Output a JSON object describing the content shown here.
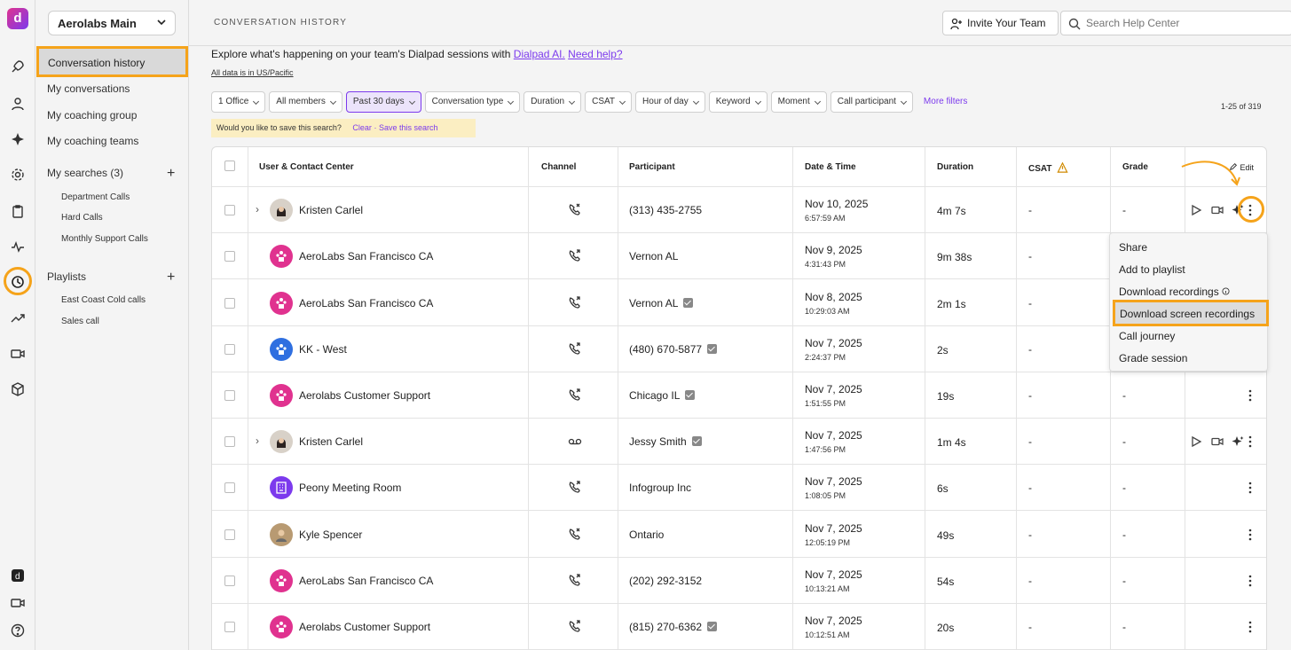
{
  "workspace": "Aerolabs Main",
  "rail_icons": [
    "rocket-icon",
    "user-icon",
    "sparkle-icon",
    "gear-icon",
    "clipboard-icon",
    "pulse-icon",
    "history-icon",
    "trend-icon",
    "video-icon",
    "cube-icon",
    "dialpad-icon",
    "camera-icon",
    "help-icon"
  ],
  "nav": {
    "active": "Conversation history",
    "items": [
      "My conversations",
      "My coaching group",
      "My coaching teams"
    ],
    "searches_label": "My searches (3)",
    "searches": [
      "Department Calls",
      "Hard Calls",
      "Monthly Support Calls"
    ],
    "playlists_label": "Playlists",
    "playlists": [
      "East Coast Cold calls",
      "Sales call"
    ]
  },
  "header": {
    "title": "CONVERSATION HISTORY",
    "invite_label": "Invite Your Team",
    "search_placeholder": "Search Help Center"
  },
  "intro": {
    "text": "Explore what's happening on your team's Dialpad sessions with",
    "link1": "Dialpad AI.",
    "link2": "Need help?",
    "timezone": "All data is in US/Pacific"
  },
  "filters": [
    "1 Office",
    "All members",
    "Past 30 days",
    "Conversation type",
    "Duration",
    "CSAT",
    "Hour of day",
    "Keyword",
    "Moment",
    "Call participant"
  ],
  "more_filters": "More filters",
  "result_count": "1-25 of 319",
  "save_bar": {
    "question": "Would you like to save this search?",
    "clear": "Clear",
    "sep": "·",
    "save": "Save this search"
  },
  "table": {
    "columns": [
      "User & Contact Center",
      "Channel",
      "Participant",
      "Date & Time",
      "Duration",
      "CSAT",
      "Grade"
    ],
    "edit_label": "Edit",
    "rows": [
      {
        "user": "Kristen Carlel",
        "participant": "(313) 435-2755",
        "date": "Nov 10, 2025",
        "time": "6:57:59 AM",
        "duration": "4m 7s",
        "csat": "-",
        "grade": "-"
      },
      {
        "user": "AeroLabs San Francisco CA",
        "participant": "Vernon AL",
        "date": "Nov 9, 2025",
        "time": "4:31:43 PM",
        "duration": "9m 38s",
        "csat": "-",
        "grade": ""
      },
      {
        "user": "AeroLabs San Francisco CA",
        "participant": "Vernon AL",
        "date": "Nov 8, 2025",
        "time": "10:29:03 AM",
        "duration": "2m 1s",
        "csat": "-",
        "grade": ""
      },
      {
        "user": "KK - West",
        "participant": "(480) 670-5877",
        "date": "Nov 7, 2025",
        "time": "2:24:37 PM",
        "duration": "2s",
        "csat": "-",
        "grade": ""
      },
      {
        "user": "Aerolabs Customer Support",
        "participant": "Chicago IL",
        "date": "Nov 7, 2025",
        "time": "1:51:55 PM",
        "duration": "19s",
        "csat": "-",
        "grade": "-"
      },
      {
        "user": "Kristen Carlel",
        "participant": "Jessy Smith",
        "date": "Nov 7, 2025",
        "time": "1:47:56 PM",
        "duration": "1m 4s",
        "csat": "-",
        "grade": "-"
      },
      {
        "user": "Peony Meeting Room",
        "participant": "Infogroup Inc",
        "date": "Nov 7, 2025",
        "time": "1:08:05 PM",
        "duration": "6s",
        "csat": "-",
        "grade": "-"
      },
      {
        "user": "Kyle Spencer",
        "participant": "Ontario",
        "date": "Nov 7, 2025",
        "time": "12:05:19 PM",
        "duration": "49s",
        "csat": "-",
        "grade": "-"
      },
      {
        "user": "AeroLabs San Francisco CA",
        "participant": "(202) 292-3152",
        "date": "Nov 7, 2025",
        "time": "10:13:21 AM",
        "duration": "54s",
        "csat": "-",
        "grade": "-"
      },
      {
        "user": "Aerolabs Customer Support",
        "participant": "(815) 270-6362",
        "date": "Nov 7, 2025",
        "time": "10:12:51 AM",
        "duration": "20s",
        "csat": "-",
        "grade": "-"
      }
    ]
  },
  "menu": [
    "Share",
    "Add to playlist",
    "Download recordings",
    "Download screen recordings",
    "Call journey",
    "Grade session"
  ],
  "colors": {
    "accent": "#7c3aed",
    "highlight": "#f5a31a",
    "brand_pink": "#e0328f",
    "blue": "#2f6fe0",
    "purple": "#7c3aed"
  }
}
